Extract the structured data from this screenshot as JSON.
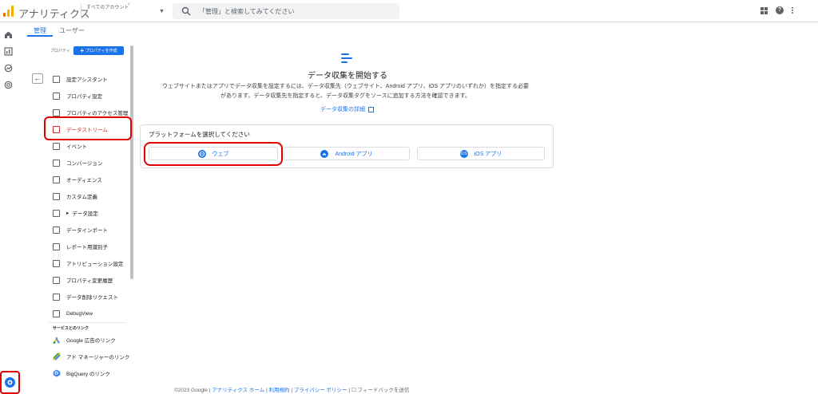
{
  "header": {
    "app_title": "アナリティクス",
    "account_label": "すべてのアカウント",
    "account_chevron": "›",
    "search_placeholder": "「管理」と検索してみてください",
    "help_glyph": "?"
  },
  "colors": {
    "accent": "#1a73e8",
    "logo_orange": "#f9ab00",
    "logo_dark_orange": "#e37400",
    "highlight_red": "#e00000",
    "active_nav_red": "#d93025"
  },
  "tabs": [
    {
      "label": "管理",
      "active": true
    },
    {
      "label": "ユーザー",
      "active": false
    }
  ],
  "nav": {
    "property_label": "プロパティ",
    "create_property_label": "プロパティを作成",
    "create_plus": "+",
    "back_glyph": "←",
    "items": [
      {
        "label": "設定アシスタント",
        "icon": "checkbox-icon"
      },
      {
        "label": "プロパティ設定",
        "icon": "property-icon"
      },
      {
        "label": "プロパティのアクセス管理",
        "icon": "people-icon"
      },
      {
        "label": "データストリーム",
        "icon": "stream-icon",
        "active": true
      },
      {
        "label": "イベント",
        "icon": "event-icon"
      },
      {
        "label": "コンバージョン",
        "icon": "flag-icon"
      },
      {
        "label": "オーディエンス",
        "icon": "audience-icon"
      },
      {
        "label": "カスタム定義",
        "icon": "custom-definition-icon"
      },
      {
        "label": "データ設定",
        "icon": "database-icon",
        "expandable": true
      },
      {
        "label": "データインポート",
        "icon": "upload-icon"
      },
      {
        "label": "レポート用識別子",
        "icon": "identifier-icon"
      },
      {
        "label": "アトリビューション設定",
        "icon": "attribution-icon"
      },
      {
        "label": "プロパティ変更履歴",
        "icon": "history-icon"
      },
      {
        "label": "データ削除リクエスト",
        "icon": "data-delete-icon"
      },
      {
        "label": "DebugView",
        "icon": "debug-icon"
      }
    ],
    "expand_glyph": "▸",
    "links_section_label": "サービスとのリンク",
    "links": [
      {
        "label": "Google 広告のリンク",
        "icon": "google-ads-icon"
      },
      {
        "label": "アド マネージャーのリンク",
        "icon": "ad-manager-icon"
      },
      {
        "label": "BigQuery のリンク",
        "icon": "bigquery-icon"
      }
    ]
  },
  "content": {
    "title": "データ収集を開始する",
    "description_line1": "ウェブサイトまたはアプリでデータ収集を設定するには、データ収集先（ウェブサイト、Android アプリ、iOS アプリのいずれか）を指定する必要",
    "description_line2": "があります。データ収集先を指定すると、データ収集タグをソースに追加する方法を確認できます。",
    "learn_more": "データ収集の詳細",
    "platform_prompt": "プラットフォームを選択してください",
    "platforms": [
      {
        "label": "ウェブ",
        "icon": "web-icon"
      },
      {
        "label": "Android アプリ",
        "icon": "android-icon"
      },
      {
        "label": "iOS アプリ",
        "icon": "ios-icon",
        "badge": "iOS"
      }
    ]
  },
  "footer": {
    "copyright": "©2023 Google",
    "sep": " | ",
    "links": [
      "アナリティクス ホーム",
      "利用規約",
      "プライバシー ポリシー"
    ],
    "feedback": "フィードバックを送信"
  }
}
